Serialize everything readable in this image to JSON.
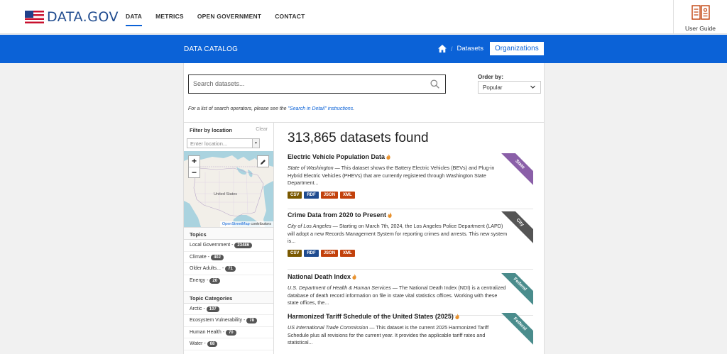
{
  "header": {
    "logo_text": "DATA.GOV",
    "nav": [
      {
        "label": "DATA",
        "active": true
      },
      {
        "label": "METRICS",
        "active": false
      },
      {
        "label": "OPEN GOVERNMENT",
        "active": false
      },
      {
        "label": "CONTACT",
        "active": false
      }
    ],
    "user_guide_label": "User Guide"
  },
  "bluebar": {
    "title": "DATA CATALOG",
    "breadcrumb_datasets": "Datasets",
    "breadcrumb_organizations": "Organizations"
  },
  "search": {
    "placeholder": "Search datasets...",
    "order_label": "Order by:",
    "order_value": "Popular",
    "hint_prefix": "For a list of search operators, please see the ",
    "hint_link": "\"Search in Detail\" instructions",
    "hint_suffix": "."
  },
  "sidebar": {
    "location": {
      "title": "Filter by location",
      "clear": "Clear",
      "placeholder": "Enter location...",
      "map_label": "United States",
      "attribution_link": "OpenStreetMap",
      "attribution_suffix": " contributors"
    },
    "topics": {
      "title": "Topics",
      "items": [
        {
          "label": "Local Government - ",
          "count": "23486"
        },
        {
          "label": "Climate - ",
          "count": "402"
        },
        {
          "label": "Older Adults... - ",
          "count": "71"
        },
        {
          "label": "Energy - ",
          "count": "20"
        }
      ]
    },
    "topic_categories": {
      "title": "Topic Categories",
      "items": [
        {
          "label": "Arctic - ",
          "count": "107"
        },
        {
          "label": "Ecosystem Vulnerability - ",
          "count": "78"
        },
        {
          "label": "Human Health - ",
          "count": "70"
        },
        {
          "label": "Water - ",
          "count": "68"
        }
      ]
    }
  },
  "results": {
    "count_text": "313,865 datasets found",
    "items": [
      {
        "title": "Electric Vehicle Population Data",
        "publisher": "State of Washington",
        "description": " — This dataset shows the Battery Electric Vehicles (BEVs) and Plug-in Hybrid Electric Vehicles (PHEVs) that are currently registered through Washington State Department...",
        "formats": [
          "CSV",
          "RDF",
          "JSON",
          "XML"
        ],
        "ribbon": "State"
      },
      {
        "title": "Crime Data from 2020 to Present",
        "publisher": "City of Los Angeles",
        "description": " — Starting on March 7th, 2024, the Los Angeles Police Department (LAPD) will adopt a new Records Management System for reporting crimes and arrests. This new system is...",
        "formats": [
          "CSV",
          "RDF",
          "JSON",
          "XML"
        ],
        "ribbon": "City"
      },
      {
        "title": "National Death Index",
        "publisher": "U.S. Department of Health & Human Services",
        "description": " — The National Death Index (NDI) is a centralized database of death record information on file in state vital statistics offices. Working with these state offices, the...",
        "formats": [],
        "ribbon": "Federal"
      },
      {
        "title": "Harmonized Tariff Schedule of the United States (2025)",
        "publisher": "US International Trade Commission",
        "description": " — This dataset is the current 2025 Harmonized Tariff Schedule plus all revisions for the current year. It provides the applicable tariff rates and statistical...",
        "formats": [],
        "ribbon": "Federal"
      }
    ]
  },
  "colors": {
    "brand_blue": "#0b62d7",
    "state_ribbon": "#8a5fa8",
    "city_ribbon": "#555555",
    "federal_ribbon": "#4a8c8c"
  }
}
